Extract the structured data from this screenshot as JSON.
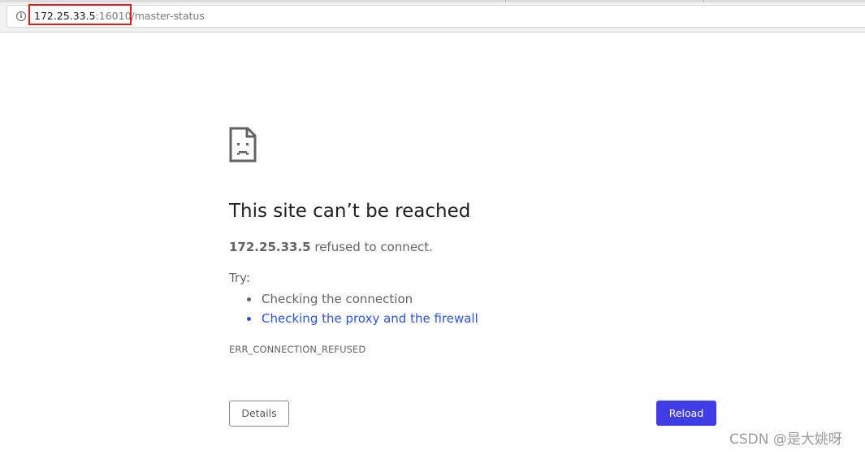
{
  "address_bar": {
    "host": "172.25.33.5",
    "port_and_path": ":16010/master-status",
    "info_icon": "info-icon",
    "highlight_color": "#e21b1b"
  },
  "error_page": {
    "icon": "sad-document-icon",
    "title": "This site can’t be reached",
    "summary_host": "172.25.33.5",
    "summary_text": " refused to connect.",
    "try_label": "Try:",
    "suggestions": [
      {
        "label": "Checking the connection",
        "is_link": false
      },
      {
        "label": "Checking the proxy and the firewall",
        "is_link": true
      }
    ],
    "error_code": "ERR_CONNECTION_REFUSED",
    "details_label": "Details",
    "reload_label": "Reload",
    "link_color": "#2b52e0",
    "reload_color": "#3f3de6"
  },
  "watermark": "CSDN @是大姚呀"
}
